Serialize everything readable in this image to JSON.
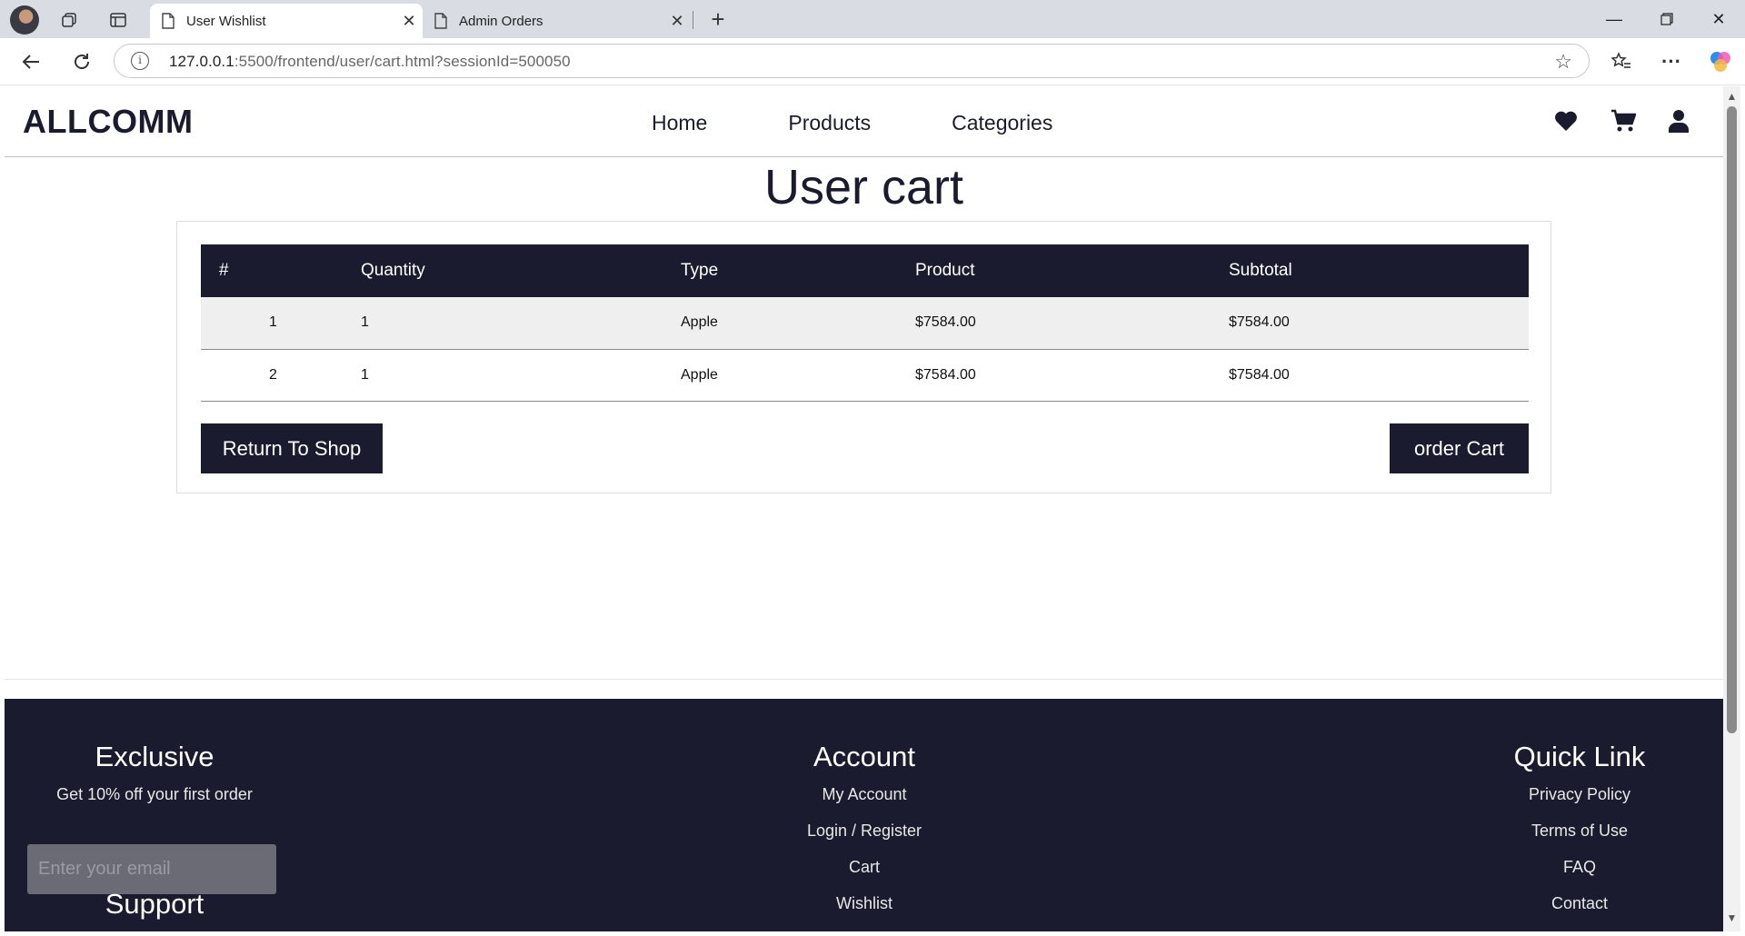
{
  "browser": {
    "tabs": [
      {
        "title": "User Wishlist",
        "active": true
      },
      {
        "title": "Admin Orders",
        "active": false
      }
    ],
    "url_host": "127.0.0.1",
    "url_rest": ":5500/frontend/user/cart.html?sessionId=500050"
  },
  "site": {
    "logo": "ALLCOMM",
    "nav": [
      "Home",
      "Products",
      "Categories"
    ],
    "header_icons": [
      "heart-icon",
      "cart-icon",
      "user-icon"
    ]
  },
  "cart": {
    "title": "User cart",
    "columns": [
      "#",
      "Quantity",
      "Type",
      "Product",
      "Subtotal"
    ],
    "rows": [
      {
        "num": "1",
        "quantity": "1",
        "type": "Apple",
        "product": "$7584.00",
        "subtotal": "$7584.00"
      },
      {
        "num": "2",
        "quantity": "1",
        "type": "Apple",
        "product": "$7584.00",
        "subtotal": "$7584.00"
      }
    ],
    "return_label": "Return To Shop",
    "order_label": "order Cart"
  },
  "footer": {
    "exclusive": {
      "heading": "Exclusive",
      "text": "Get 10% off your first order",
      "email_placeholder": "Enter your email"
    },
    "support_heading": "Support",
    "account": {
      "heading": "Account",
      "links": [
        "My Account",
        "Login / Register",
        "Cart",
        "Wishlist"
      ]
    },
    "quick": {
      "heading": "Quick Link",
      "links": [
        "Privacy Policy",
        "Terms of Use",
        "FAQ",
        "Contact"
      ]
    }
  },
  "colors": {
    "brand": "#1b1b2f",
    "row_shade": "#efefef"
  }
}
